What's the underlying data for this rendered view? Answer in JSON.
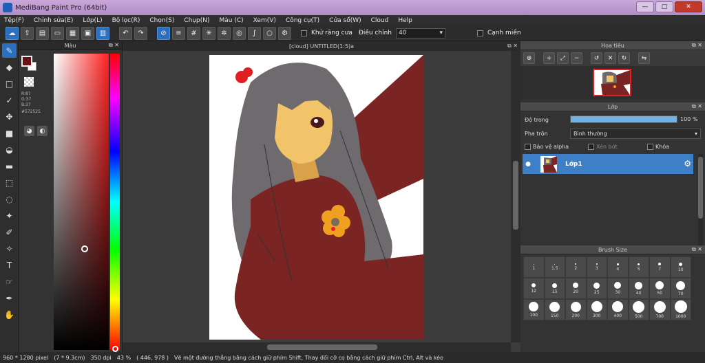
{
  "window": {
    "title": "MediBang Paint Pro (64bit)",
    "minimize": "—",
    "maximize": "□",
    "close": "✕"
  },
  "menu": [
    "Tệp(F)",
    "Chỉnh sửa(E)",
    "Lớp(L)",
    "Bộ lọc(R)",
    "Chọn(S)",
    "Chụp(N)",
    "Màu (C)",
    "Xem(V)",
    "Công cụ(T)",
    "Cửa sổ(W)",
    "Cloud",
    "Help"
  ],
  "toolbar": {
    "antialias_label": "Khử răng cưa",
    "adjust_label": "Điều chỉnh",
    "adjust_value": "40",
    "edge_label": "Cạnh miền"
  },
  "color_panel": {
    "title": "Màu",
    "r": "R:87",
    "g": "G:37",
    "b": "B:37",
    "hex": "#572525",
    "fg_color": "#6b1010"
  },
  "document": {
    "tab_title": "[cloud] UNTITLED(1:5)a"
  },
  "navigator": {
    "title": "Hoa tiêu"
  },
  "layer_panel": {
    "title": "Lớp",
    "opacity_label": "Độ trong",
    "opacity_value": "100 %",
    "opacity_fraction": 1.0,
    "blend_label": "Pha trộn",
    "blend_value": "Bình thường",
    "protect_alpha": "Bảo vệ alpha",
    "clipping": "Xén bớt",
    "lock": "Khóa",
    "layer_name": "Lớp1"
  },
  "brush_panel": {
    "title": "Brush Size",
    "sizes": [
      "1",
      "1.5",
      "2",
      "3",
      "4",
      "5",
      "7",
      "10",
      "12",
      "15",
      "20",
      "25",
      "30",
      "40",
      "50",
      "70",
      "100",
      "150",
      "200",
      "300",
      "400",
      "500",
      "700",
      "1000"
    ]
  },
  "status": {
    "size": "960 * 1280 pixel",
    "dims": "(7 * 9.3cm)",
    "dpi": "350 dpi",
    "zoom": "43 %",
    "coords": "( 446, 978 )",
    "hint": "Vẽ một đường thẳng bằng cách giữ phím Shift, Thay đổi cỡ cọ bằng cách giữ phím Ctrl, Alt và kéo"
  },
  "colors": {
    "accent": "#2b6fbf",
    "layer_selected": "#3d80c7",
    "shirt": "#7a2424",
    "hair": "#6e6a6e",
    "skin": "#f2c46a",
    "flower": "#f0a020"
  }
}
